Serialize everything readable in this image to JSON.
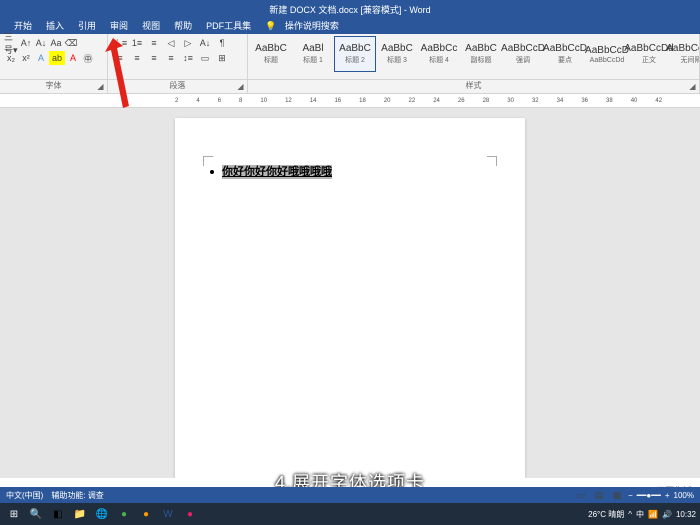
{
  "title": "新建 DOCX 文档.docx [兼容模式] - Word",
  "tabs": [
    "开始",
    "插入",
    "引用",
    "审阅",
    "视图",
    "帮助",
    "PDF工具集"
  ],
  "search_hint": "操作说明搜索",
  "groups": {
    "font": "字体",
    "paragraph": "段落",
    "styles": "样式"
  },
  "styles": [
    {
      "preview": "AaBbC",
      "lbl": "标题"
    },
    {
      "preview": "AaBl",
      "lbl": "标题 1"
    },
    {
      "preview": "AaBbC",
      "lbl": "标题 2",
      "sel": true
    },
    {
      "preview": "AaBbC",
      "lbl": "标题 3"
    },
    {
      "preview": "AaBbCc",
      "lbl": "标题 4"
    },
    {
      "preview": "AaBbC",
      "lbl": "副标题"
    },
    {
      "preview": "AaBbCcD",
      "lbl": "强调"
    },
    {
      "preview": "AaBbCcD",
      "lbl": "要点"
    },
    {
      "preview": "AaBbCcD",
      "lbl": "AaBbCcDd"
    },
    {
      "preview": "AaBbCcDd",
      "lbl": "正文"
    },
    {
      "preview": "AaBbCcDd",
      "lbl": "无间隔"
    }
  ],
  "ruler": [
    "2",
    "4",
    "6",
    "8",
    "10",
    "12",
    "14",
    "16",
    "18",
    "20",
    "22",
    "24",
    "26",
    "28",
    "30",
    "32",
    "34",
    "36",
    "38",
    "40",
    "42"
  ],
  "doc_text": "你好你好你好哦哦哦哦",
  "status": {
    "lang": "中文(中国)",
    "access": "辅助功能: 调查",
    "zoom": "100%"
  },
  "taskbar": {
    "weather": "26°C 晴朗",
    "time": "10:32"
  },
  "caption": "4.展开字体选项卡",
  "watermark": "天哥生活"
}
